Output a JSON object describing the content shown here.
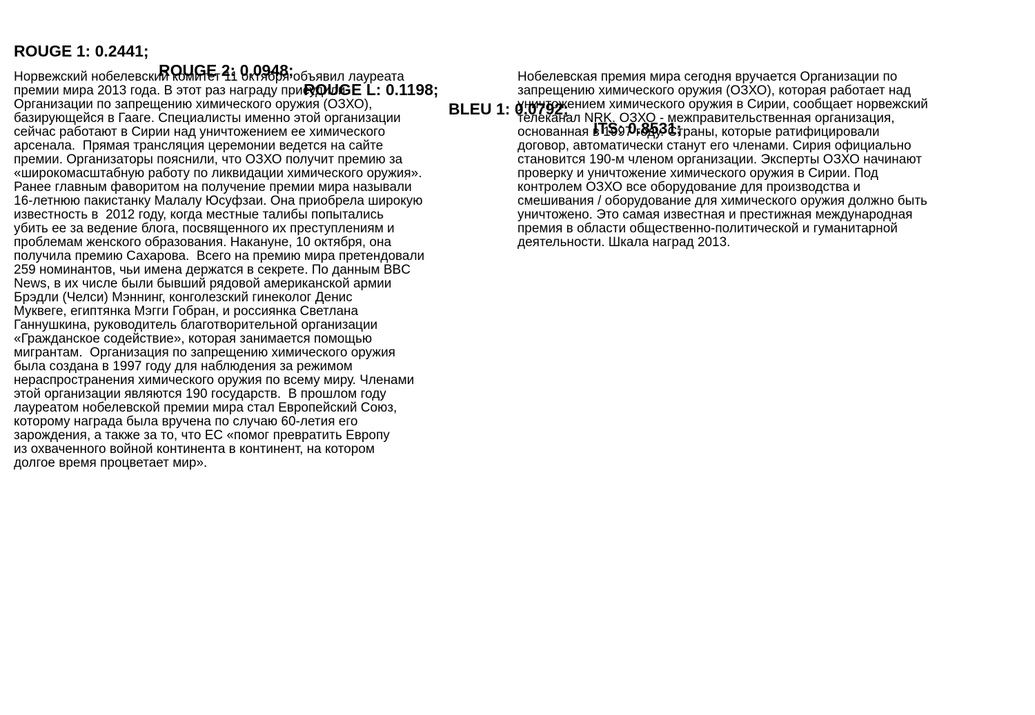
{
  "metrics": {
    "rouge1": "ROUGE 1: 0.2441;",
    "rouge2": "ROUGE 2: 0.0948;",
    "rougeL": "ROUGE L: 0.1198;",
    "bleu1": "BLEU 1: 0.0792;",
    "its": "ITS: 0.8531;"
  },
  "reference_text": {
    "lines": [
      "Норвежский нобелевский комитет 11 октября объявил лауреата",
      "премии мира 2013 года. В этот раз награду присудили",
      "Организации по запрещению химического оружия (ОЗХО),",
      "базирующейся в Гааге. Специалисты именно этой организации",
      "сейчас работают в Сирии над уничтожением ее химического",
      "арсенала.  Прямая трансляция церемонии ведется на сайте",
      "премии. Организаторы пояснили, что ОЗХО получит премию за",
      "«широкомасштабную работу по ликвидации химического оружия».",
      "Ранее главным фаворитом на получение премии мира называли",
      "16-летнюю пакистанку Малалу Юсуфзаи. Она приобрела широкую",
      "известность в  2012 году, когда местные талибы попытались",
      "убить ее за ведение блога, посвященного их преступлениям и",
      "проблемам женского образования. Накануне, 10 октября, она",
      "получила премию Сахарова.  Всего на премию мира претендовали",
      "259 номинантов, чьи имена держатся в секрете. По данным BBC",
      "News, в их числе были бывший рядовой американской армии",
      "Брэдли (Челси) Мэннинг, конголезский гинеколог Денис",
      "Муквеге, египтянка Мэгги Гобран, и россиянка Светлана",
      "Ганнушкина, руководитель благотворительной организации",
      "«Гражданское содействие», которая занимается помощью",
      "мигрантам.  Организация по запрещению химического оружия",
      "была создана в 1997 году для наблюдения за режимом",
      "нераспространения химического оружия по всему миру. Членами",
      "этой организации являются 190 государств.  В прошлом году",
      "лауреатом нобелевской премии мира стал Европейский Союз,",
      "которому награда была вручена по случаю 60-летия его",
      "зарождения, а также за то, что ЕС «помог превратить Европу",
      "из охваченного войной континента в континент, на котором",
      "долгое время процветает мир»."
    ]
  },
  "generated_text": {
    "lines": [
      "Нобелевская премия мира сегодня вручается Организации по",
      "запрещению химического оружия (ОЗХО), которая работает над",
      "уничтожением химического оружия в Сирии, сообщает норвежский",
      "телеканал NRK. ОЗХО - межправительственная организация,",
      "основанная в 1997 году. Страны, которые ратифицировали",
      "договор, автоматически станут его членами. Сирия официально",
      "становится 190-м членом организации. Эксперты ОЗХО начинают",
      "проверку и уничтожение химического оружия в Сирии. Под",
      "контролем ОЗХО все оборудование для производства и",
      "смешивания / оборудование для химического оружия должно быть",
      "уничтожено. Это самая известная и престижная международная",
      "премия в области общественно-политической и гуманитарной",
      "деятельности. Шкала наград 2013."
    ]
  }
}
